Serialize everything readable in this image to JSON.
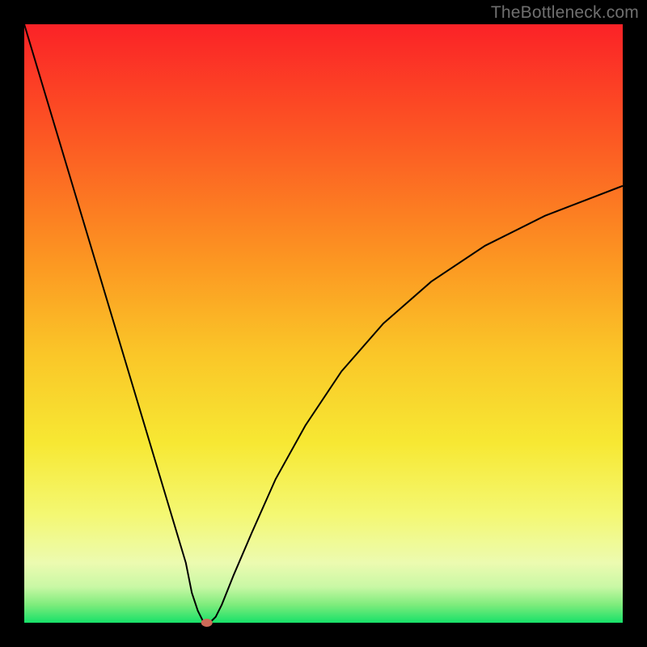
{
  "watermark": "TheBottleneck.com",
  "gradient_colors": {
    "c0": "#fb2227",
    "c20": "#fc5b23",
    "c40": "#fc9822",
    "c55": "#fac628",
    "c70": "#f7e833",
    "c82": "#f4f873",
    "c90": "#ecfbb0",
    "c94": "#c9f8a5",
    "c97": "#7eec7c",
    "c100": "#17e169"
  },
  "marker_color": "#cd6a58",
  "curve_color": "#000000",
  "chart_data": {
    "type": "line",
    "title": "",
    "xlabel": "",
    "ylabel": "",
    "xlim": [
      0,
      100
    ],
    "ylim": [
      0,
      100
    ],
    "series": [
      {
        "name": "bottleneck-curve",
        "x": [
          0,
          3,
          6,
          9,
          12,
          15,
          18,
          21,
          24,
          27,
          28,
          29,
          30,
          31,
          32,
          33,
          35,
          38,
          42,
          47,
          53,
          60,
          68,
          77,
          87,
          100
        ],
        "values": [
          100,
          90,
          80,
          70,
          60,
          50,
          40,
          30,
          20,
          10,
          5,
          2,
          0,
          0,
          1,
          3,
          8,
          15,
          24,
          33,
          42,
          50,
          57,
          63,
          68,
          73
        ]
      }
    ],
    "annotations": [
      {
        "name": "optimal-marker",
        "x": 30.5,
        "y": 0
      }
    ]
  }
}
